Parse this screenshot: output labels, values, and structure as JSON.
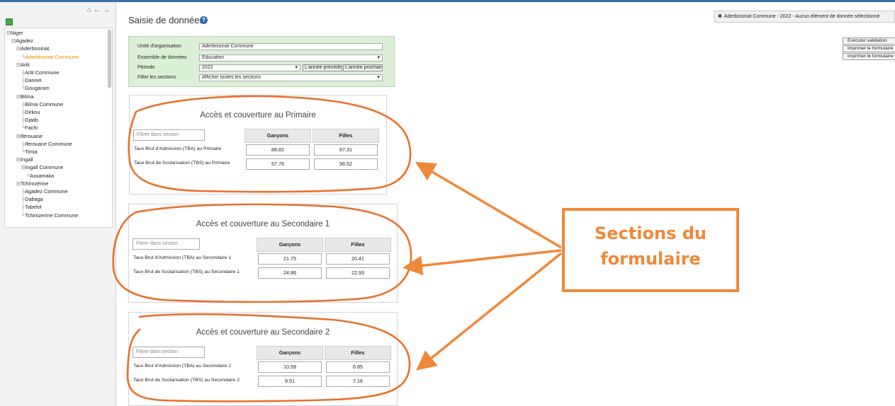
{
  "tree": {
    "items": [
      {
        "prefix": "⊟",
        "label": "Niger",
        "indent": 0
      },
      {
        "prefix": "⊟",
        "label": "Agadez",
        "indent": 1
      },
      {
        "prefix": "⊟",
        "label": "Aderbissinat",
        "indent": 2
      },
      {
        "prefix": "└",
        "label": "Aderbissinat Commune",
        "indent": 3,
        "selected": true
      },
      {
        "prefix": "⊟",
        "label": "Arlit",
        "indent": 2
      },
      {
        "prefix": "├",
        "label": "Arlit Commune",
        "indent": 3
      },
      {
        "prefix": "├",
        "label": "Dannet",
        "indent": 3
      },
      {
        "prefix": "└",
        "label": "Gougaram",
        "indent": 3
      },
      {
        "prefix": "⊟",
        "label": "Bilma",
        "indent": 2
      },
      {
        "prefix": "├",
        "label": "Bilma Commune",
        "indent": 3
      },
      {
        "prefix": "├",
        "label": "Dirkou",
        "indent": 3
      },
      {
        "prefix": "├",
        "label": "Djado",
        "indent": 3
      },
      {
        "prefix": "└",
        "label": "Fachi",
        "indent": 3
      },
      {
        "prefix": "⊟",
        "label": "Iférouane",
        "indent": 2
      },
      {
        "prefix": "├",
        "label": "Iferouane Commune",
        "indent": 3
      },
      {
        "prefix": "└",
        "label": "Timia",
        "indent": 3
      },
      {
        "prefix": "⊟",
        "label": "Ingall",
        "indent": 2
      },
      {
        "prefix": "⊟",
        "label": "Ingall Commune",
        "indent": 3
      },
      {
        "prefix": "└",
        "label": "Assamaka",
        "indent": 4
      },
      {
        "prefix": "⊟",
        "label": "Tchirozérine",
        "indent": 2
      },
      {
        "prefix": "├",
        "label": "Agadez Commune",
        "indent": 3
      },
      {
        "prefix": "├",
        "label": "Dabaga",
        "indent": 3
      },
      {
        "prefix": "├",
        "label": "Tabelot",
        "indent": 3
      },
      {
        "prefix": "└",
        "label": "Tchirozerine Commune",
        "indent": 3
      }
    ]
  },
  "header": {
    "title": "Saisie de données",
    "help_icon": "?"
  },
  "status": {
    "close_icon": "✖",
    "text": "Aderbissinat Commune - 2022 - Aucun élément de donnée sélectionné"
  },
  "actions": {
    "run_validation": "Exécuter validation",
    "print_form": "Imprimer le formulaire",
    "print_blank_form": "Imprimer le formulaire vierge"
  },
  "selectors": {
    "org_unit_label": "Unité d'organisation",
    "org_unit_value": "Aderbissinat Commune",
    "dataset_label": "Ensemble de données",
    "dataset_value": "Education",
    "period_label": "Période",
    "period_value": "2022",
    "prev_year": "L'année précédente",
    "next_year": "L'année prochaine",
    "filter_sections_label": "Filter les sections",
    "filter_sections_value": "Afficher toutes les sections"
  },
  "sections": [
    {
      "title": "Accès et couverture au Primaire",
      "filter_placeholder": "Filtrer dans section",
      "col_boys": "Garçons",
      "col_girls": "Filles",
      "rows": [
        {
          "label": "Taux Brut d'Admission (TBA) au Primaire",
          "boys": "88.82",
          "girls": "87.31"
        },
        {
          "label": "Taux Brut de Scolarisation (TBS) au Primaire",
          "boys": "57.76",
          "girls": "56.52"
        }
      ]
    },
    {
      "title": "Accès et couverture au Secondaire 1",
      "filter_placeholder": "Filtrer dans section",
      "col_boys": "Garçons",
      "col_girls": "Filles",
      "rows": [
        {
          "label": "Taux Brut d'Admission (TBA) au Secondaire 1",
          "boys": "21.75",
          "girls": "20.41"
        },
        {
          "label": "Taux Brut de Scolarisation (TBS) au Secondaire 1",
          "boys": "24.86",
          "girls": "22.93"
        }
      ]
    },
    {
      "title": "Accès et couverture au Secondaire 2",
      "filter_placeholder": "Filtrer dans section",
      "col_boys": "Garçons",
      "col_girls": "Filles",
      "rows": [
        {
          "label": "Taux Brut d'Admission (TBA) au Secondaire 2",
          "boys": "10.59",
          "girls": "6.85"
        },
        {
          "label": "Taux Brut de Scolarisation (TBS) au Secondaire 2",
          "boys": "9.51",
          "girls": "7.16"
        }
      ]
    }
  ],
  "annotation": {
    "line1": "Sections du",
    "line2": "formulaire",
    "color": "#f0883a"
  }
}
